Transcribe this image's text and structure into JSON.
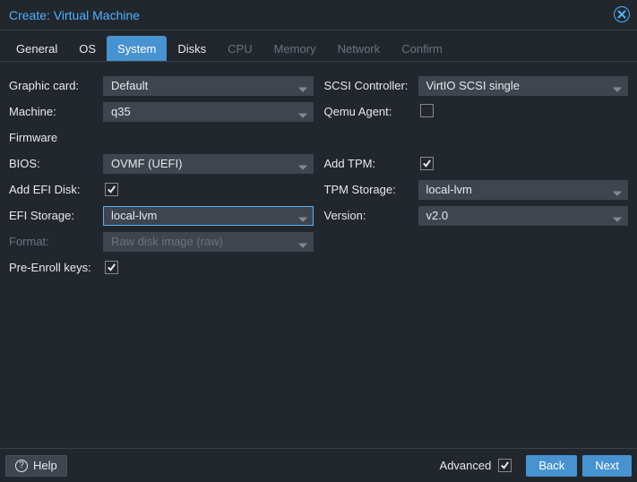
{
  "title": "Create: Virtual Machine",
  "tabs": {
    "general": "General",
    "os": "OS",
    "system": "System",
    "disks": "Disks",
    "cpu": "CPU",
    "memory": "Memory",
    "network": "Network",
    "confirm": "Confirm"
  },
  "form": {
    "graphic_card": {
      "label": "Graphic card:",
      "value": "Default"
    },
    "machine": {
      "label": "Machine:",
      "value": "q35"
    },
    "firmware": {
      "label": "Firmware"
    },
    "bios": {
      "label": "BIOS:",
      "value": "OVMF (UEFI)"
    },
    "add_efi_disk": {
      "label": "Add EFI Disk:",
      "checked": true
    },
    "efi_storage": {
      "label": "EFI Storage:",
      "value": "local-lvm"
    },
    "format": {
      "label": "Format:",
      "value": "Raw disk image (raw)"
    },
    "pre_enroll": {
      "label": "Pre-Enroll keys:",
      "checked": true
    },
    "scsi": {
      "label": "SCSI Controller:",
      "value": "VirtIO SCSI single"
    },
    "qemu_agent": {
      "label": "Qemu Agent:",
      "checked": false
    },
    "add_tpm": {
      "label": "Add TPM:",
      "checked": true
    },
    "tpm_storage": {
      "label": "TPM Storage:",
      "value": "local-lvm"
    },
    "version": {
      "label": "Version:",
      "value": "v2.0"
    }
  },
  "footer": {
    "help": "Help",
    "advanced": "Advanced",
    "advanced_checked": true,
    "back": "Back",
    "next": "Next"
  }
}
